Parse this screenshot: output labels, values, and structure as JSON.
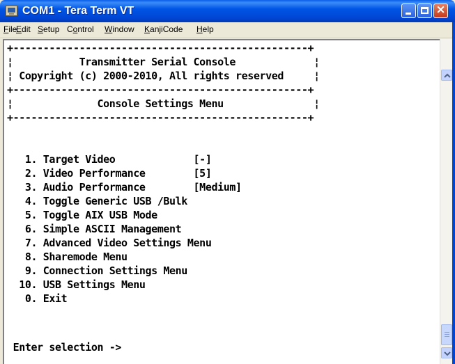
{
  "window": {
    "title": "COM1 - Tera Term VT",
    "controls": {
      "minimize": "minimize",
      "maximize": "maximize",
      "close": "close"
    },
    "close_glyph": "×"
  },
  "menubar": {
    "items": [
      {
        "underline": "F",
        "rest": "ile"
      },
      {
        "underline": "E",
        "rest": "dit"
      },
      {
        "underline": "S",
        "rest": "etup"
      },
      {
        "pre": "C",
        "underline": "o",
        "rest": "ntrol"
      },
      {
        "underline": "W",
        "rest": "indow"
      },
      {
        "underline": "K",
        "rest": "anjiCode"
      },
      {
        "underline": "H",
        "rest": "elp"
      }
    ]
  },
  "terminal": {
    "lines": [
      "+-------------------------------------------------+",
      "¦           Transmitter Serial Console             ¦",
      "¦ Copyright (c) 2000-2010, All rights reserved     ¦",
      "+-------------------------------------------------+",
      "¦              Console Settings Menu               ¦",
      "+-------------------------------------------------+",
      "",
      "",
      "   1. Target Video             [-]",
      "   2. Video Performance        [5]",
      "   3. Audio Performance        [Medium]",
      "   4. Toggle Generic USB /Bulk",
      "   5. Toggle AIX USB Mode",
      "   6. Simple ASCII Management",
      "   7. Advanced Video Settings Menu",
      "   8. Sharemode Menu",
      "   9. Connection Settings Menu",
      "  10. USB Settings Menu",
      "   0. Exit",
      "",
      " Enter selection ->"
    ]
  },
  "icons": {
    "app": "terminal-app-icon",
    "scroll_up": "scroll-up-arrow-icon",
    "scroll_down": "scroll-down-arrow-icon"
  },
  "colors": {
    "titlebar": "#0055e5",
    "terminal_bg": "#ffffff",
    "terminal_fg": "#000000",
    "close_button": "#c5391a"
  }
}
